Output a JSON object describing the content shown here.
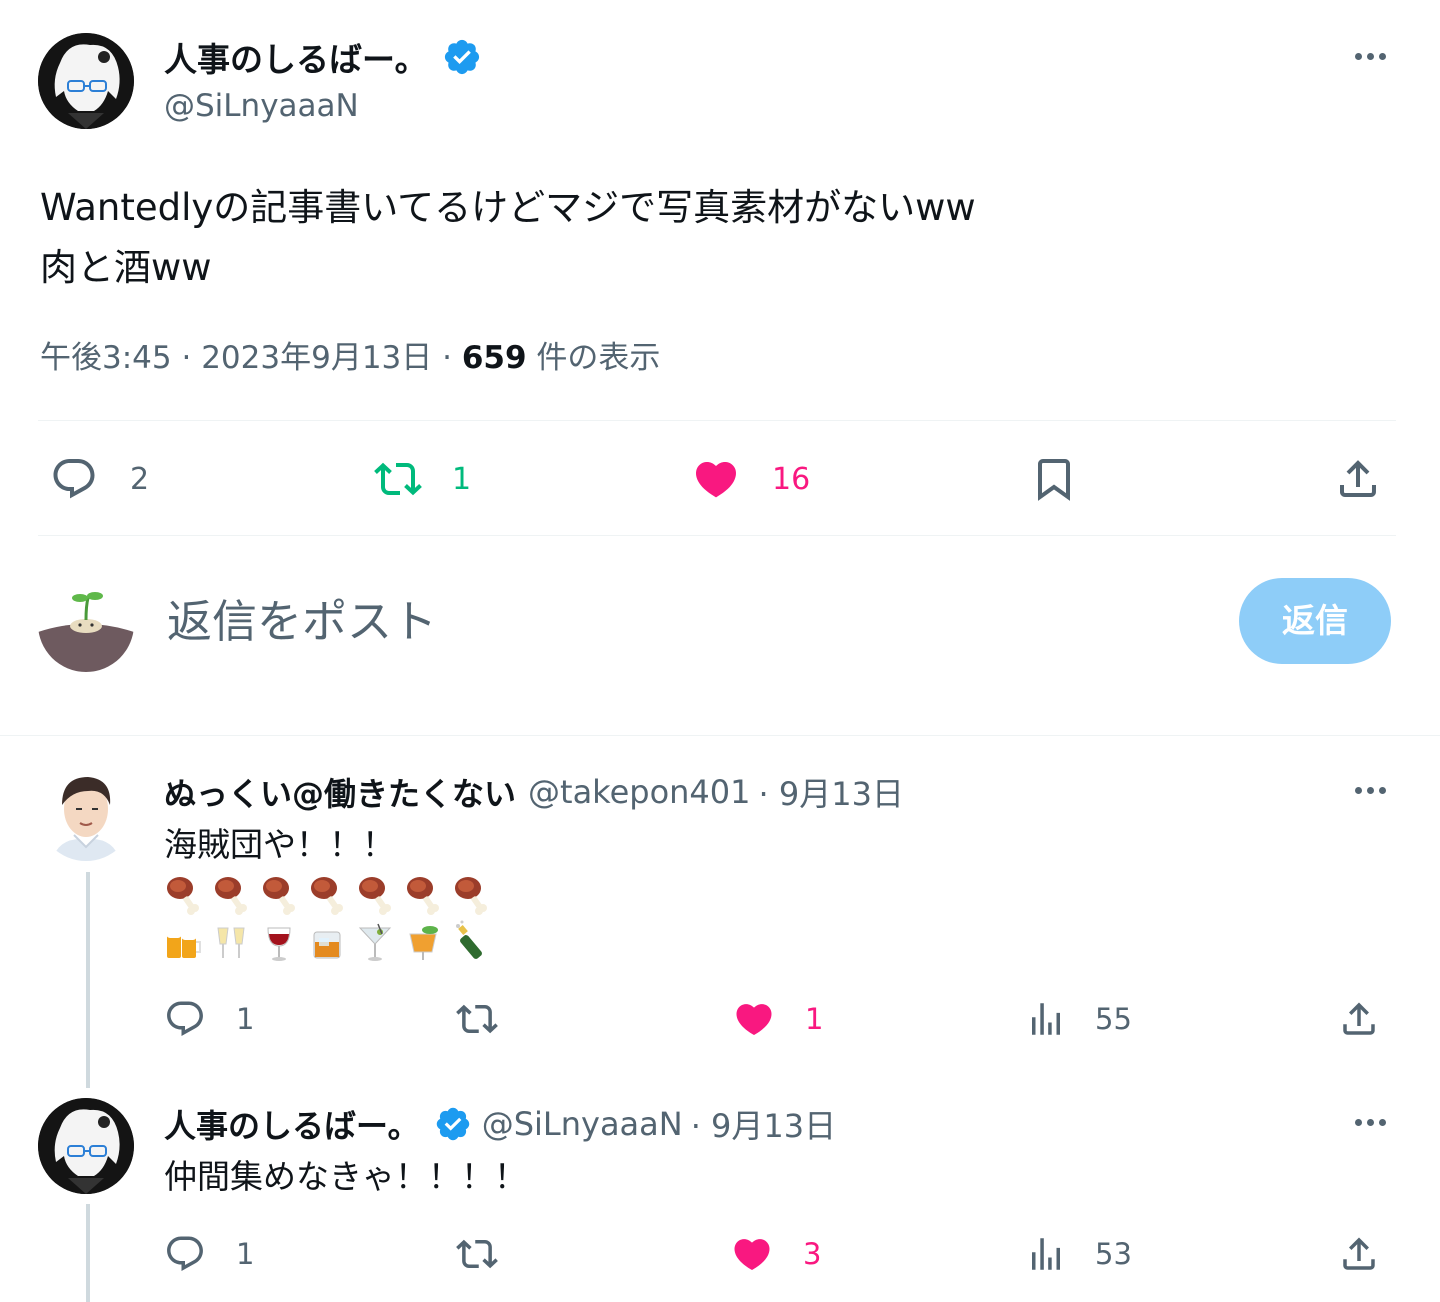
{
  "main_tweet": {
    "author_name": "人事のしるばー。",
    "author_handle": "@SiLnyaaaN",
    "text_line1": "Wantedlyの記事書いてるけどマジで写真素材がないww",
    "text_line2": "肉と酒ww",
    "time": "午後3:45",
    "date": "2023年9月13日",
    "views_count": "659",
    "views_label": "件の表示",
    "separator": "·",
    "stats": {
      "replies": "2",
      "retweets": "1",
      "likes": "16"
    }
  },
  "reply_box": {
    "placeholder": "返信をポスト",
    "button_label": "返信"
  },
  "replies": [
    {
      "author_name": "ぬっくい@働きたくない",
      "author_handle": "@takepon401",
      "date": "· 9月13日",
      "text": "海賊団や！！！",
      "emoji_row1": [
        "meat-on-bone",
        "meat-on-bone",
        "meat-on-bone",
        "meat-on-bone",
        "meat-on-bone",
        "meat-on-bone",
        "meat-on-bone"
      ],
      "emoji_row2": [
        "clinking-beer-mugs",
        "clinking-glasses",
        "wine-glass",
        "tumbler-glass",
        "cocktail-glass",
        "tropical-drink",
        "champagne-bottle"
      ],
      "stats": {
        "replies": "1",
        "likes": "1",
        "views": "55"
      }
    },
    {
      "author_name": "人事のしるばー。",
      "author_handle": "@SiLnyaaaN",
      "date": "· 9月13日",
      "text": "仲間集めなきゃ！！！！",
      "stats": {
        "replies": "1",
        "likes": "3",
        "views": "53"
      }
    }
  ],
  "colors": {
    "text": "#0f1419",
    "secondary": "#536471",
    "verified": "#1d9bf0",
    "like": "#f91880",
    "retweet": "#00ba7c",
    "reply_button": "#8ecdf8"
  }
}
